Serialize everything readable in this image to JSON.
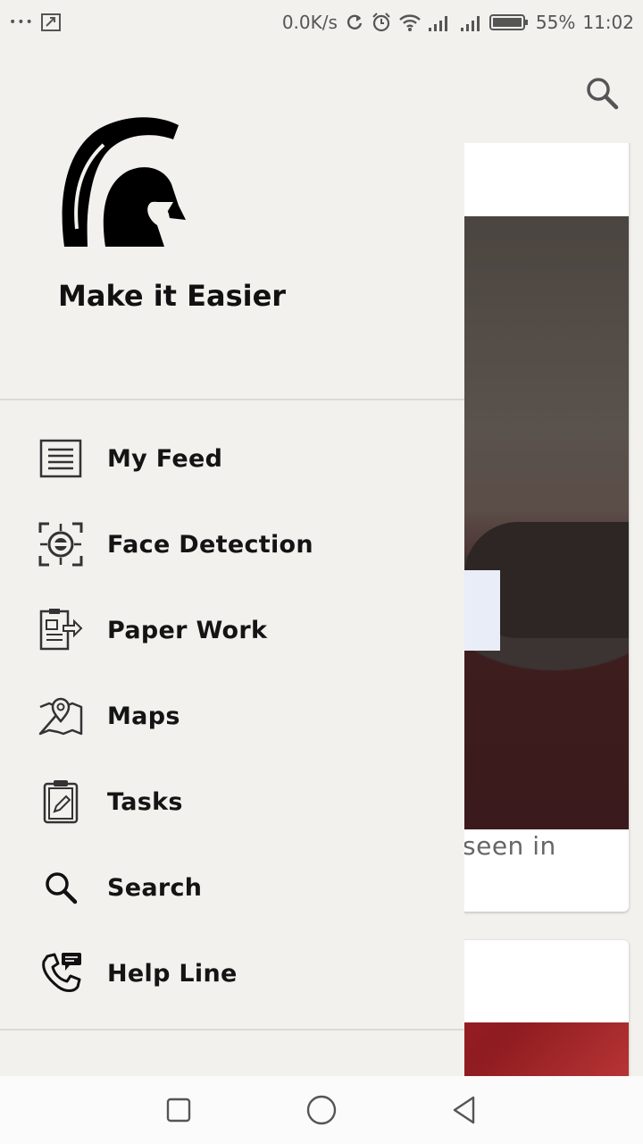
{
  "status_bar": {
    "dots": "•••",
    "net_speed": "0.0K/s",
    "battery": "55%",
    "time": "11:02"
  },
  "drawer": {
    "app_name": "Make it Easier",
    "logo_icon": "spartan-helmet-icon",
    "items": [
      {
        "label": "My Feed",
        "icon": "feed-list-icon"
      },
      {
        "label": "Face Detection",
        "icon": "face-detection-icon"
      },
      {
        "label": "Paper Work",
        "icon": "paper-work-icon"
      },
      {
        "label": "Maps",
        "icon": "map-pin-icon"
      },
      {
        "label": "Tasks",
        "icon": "clipboard-edit-icon"
      },
      {
        "label": "Search",
        "icon": "search-icon"
      },
      {
        "label": "Help Line",
        "icon": "phone-chat-icon"
      }
    ]
  },
  "background": {
    "card_snippet": "seen in"
  },
  "colors": {
    "background": "#f2f1ee",
    "text": "#141414",
    "divider": "#dcdad6"
  }
}
